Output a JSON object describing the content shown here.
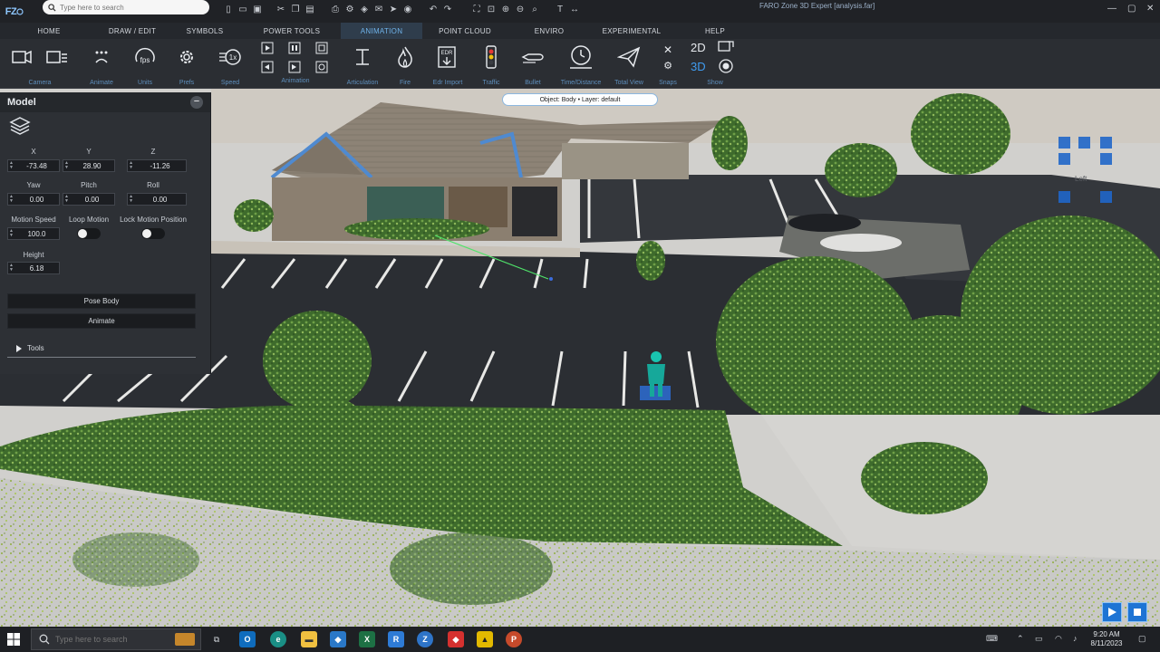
{
  "app": {
    "logo_text": "FZ",
    "search_placeholder": "Type here to search",
    "window_title": "FARO Zone 3D Expert [analysis.far]"
  },
  "menu": {
    "tabs": [
      "HOME",
      "DRAW / EDIT",
      "SYMBOLS",
      "POWER TOOLS",
      "ANIMATION",
      "POINT CLOUD",
      "ENVIRO",
      "EXPERIMENTAL",
      "HELP"
    ],
    "active": "ANIMATION"
  },
  "ribbon": {
    "groups": [
      "Camera",
      "Animate",
      "Units",
      "Prefs",
      "Speed",
      "Animation",
      "Articulation",
      "Fire",
      "Edr Import",
      "Traffic",
      "Bullet",
      "Time/Distance",
      "Total View",
      "Snaps",
      "Show"
    ],
    "units_icon_text": "fps",
    "speed_icon_text": "1x",
    "edr_icon_text": "EDR",
    "show_2d": "2D",
    "show_3d": "3D"
  },
  "viewport": {
    "object_label": "Object: Body  •  Layer: default",
    "navcube_label": "Left"
  },
  "panel": {
    "title": "Model",
    "collapse_symbol": "−",
    "x_label": "X",
    "y_label": "Y",
    "z_label": "Z",
    "x_value": "-73.48",
    "y_value": "28.90",
    "z_value": "-11.26",
    "yaw_label": "Yaw",
    "pitch_label": "Pitch",
    "roll_label": "Roll",
    "yaw_value": "0.00",
    "pitch_value": "0.00",
    "roll_value": "0.00",
    "motion_speed_label": "Motion Speed",
    "motion_speed_value": "100.0",
    "loop_motion_label": "Loop Motion",
    "lock_motion_label": "Lock Motion Position",
    "loop_motion_on": false,
    "lock_motion_on": false,
    "height_label": "Height",
    "height_value": "6.18",
    "pose_body_button": "Pose Body",
    "animate_button": "Animate",
    "tools_label": "Tools"
  },
  "taskbar": {
    "search_placeholder": "Type here to search",
    "time": "9:20 AM",
    "date": "8/11/2023"
  },
  "colors": {
    "accent": "#1e74d4",
    "active_tab_text": "#6fb3ea",
    "ribbon_label": "#5e8fbd"
  }
}
